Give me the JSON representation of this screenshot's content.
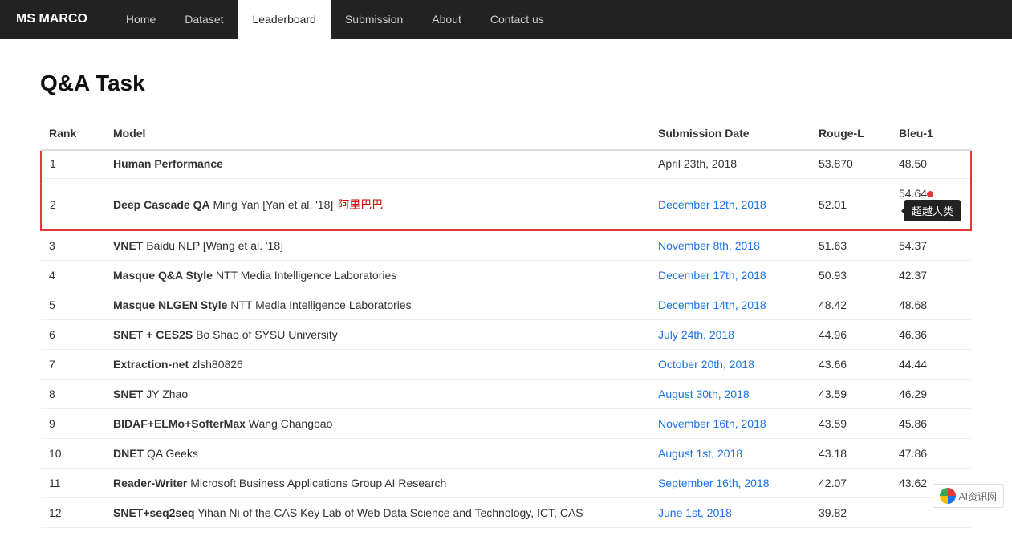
{
  "brand": "MS MARCO",
  "nav": {
    "links": [
      {
        "label": "Home",
        "active": false
      },
      {
        "label": "Dataset",
        "active": false
      },
      {
        "label": "Leaderboard",
        "active": true
      },
      {
        "label": "Submission",
        "active": false
      },
      {
        "label": "About",
        "active": false
      },
      {
        "label": "Contact us",
        "active": false
      }
    ]
  },
  "page": {
    "title": "Q&A Task"
  },
  "table": {
    "headers": [
      "Rank",
      "Model",
      "Submission Date",
      "Rouge-L",
      "Bleu-1"
    ],
    "rows": [
      {
        "rank": "1",
        "model_bold": "Human Performance",
        "model_rest": "",
        "date": "April 23th, 2018",
        "date_link": false,
        "rouge": "53.870",
        "bleu": "48.50",
        "highlighted": true,
        "human": true
      },
      {
        "rank": "2",
        "model_bold": "Deep Cascade QA",
        "model_rest": "Ming Yan [Yan et al. '18]",
        "model_chinese": "阿里巴巴",
        "date": "December 12th, 2018",
        "date_link": true,
        "rouge": "52.01",
        "bleu": "54.64",
        "highlighted": true,
        "badge": "超越人类",
        "exceeds": true
      },
      {
        "rank": "3",
        "model_bold": "VNET",
        "model_rest": "Baidu NLP [Wang et al. '18]",
        "date": "November 8th, 2018",
        "date_link": true,
        "rouge": "51.63",
        "bleu": "54.37"
      },
      {
        "rank": "4",
        "model_bold": "Masque Q&A Style",
        "model_rest": "NTT Media Intelligence Laboratories",
        "date": "December 17th, 2018",
        "date_link": true,
        "rouge": "50.93",
        "bleu": "42.37"
      },
      {
        "rank": "5",
        "model_bold": "Masque NLGEN Style",
        "model_rest": "NTT Media Intelligence Laboratories",
        "date": "December 14th, 2018",
        "date_link": true,
        "rouge": "48.42",
        "bleu": "48.68"
      },
      {
        "rank": "6",
        "model_bold": "SNET + CES2S",
        "model_rest": "Bo Shao of SYSU University",
        "date": "July 24th, 2018",
        "date_link": true,
        "rouge": "44.96",
        "bleu": "46.36"
      },
      {
        "rank": "7",
        "model_bold": "Extraction-net",
        "model_rest": "zlsh80826",
        "date": "October 20th, 2018",
        "date_link": true,
        "rouge": "43.66",
        "bleu": "44.44"
      },
      {
        "rank": "8",
        "model_bold": "SNET",
        "model_rest": "JY Zhao",
        "date": "August 30th, 2018",
        "date_link": true,
        "rouge": "43.59",
        "bleu": "46.29"
      },
      {
        "rank": "9",
        "model_bold": "BIDAF+ELMo+SofterMax",
        "model_rest": "Wang Changbao",
        "date": "November 16th, 2018",
        "date_link": true,
        "rouge": "43.59",
        "bleu": "45.86"
      },
      {
        "rank": "10",
        "model_bold": "DNET",
        "model_rest": "QA Geeks",
        "date": "August 1st, 2018",
        "date_link": true,
        "rouge": "43.18",
        "bleu": "47.86"
      },
      {
        "rank": "11",
        "model_bold": "Reader-Writer",
        "model_rest": "Microsoft Business Applications Group AI Research",
        "date": "September 16th, 2018",
        "date_link": true,
        "rouge": "42.07",
        "bleu": "43.62"
      },
      {
        "rank": "12",
        "model_bold": "SNET+seq2seq",
        "model_rest": "Yihan Ni of the CAS Key Lab of Web Data Science and Technology, ICT, CAS",
        "date": "June 1st, 2018",
        "date_link": true,
        "rouge": "39.82",
        "bleu": ""
      }
    ]
  },
  "watermark": "AI资讯网"
}
